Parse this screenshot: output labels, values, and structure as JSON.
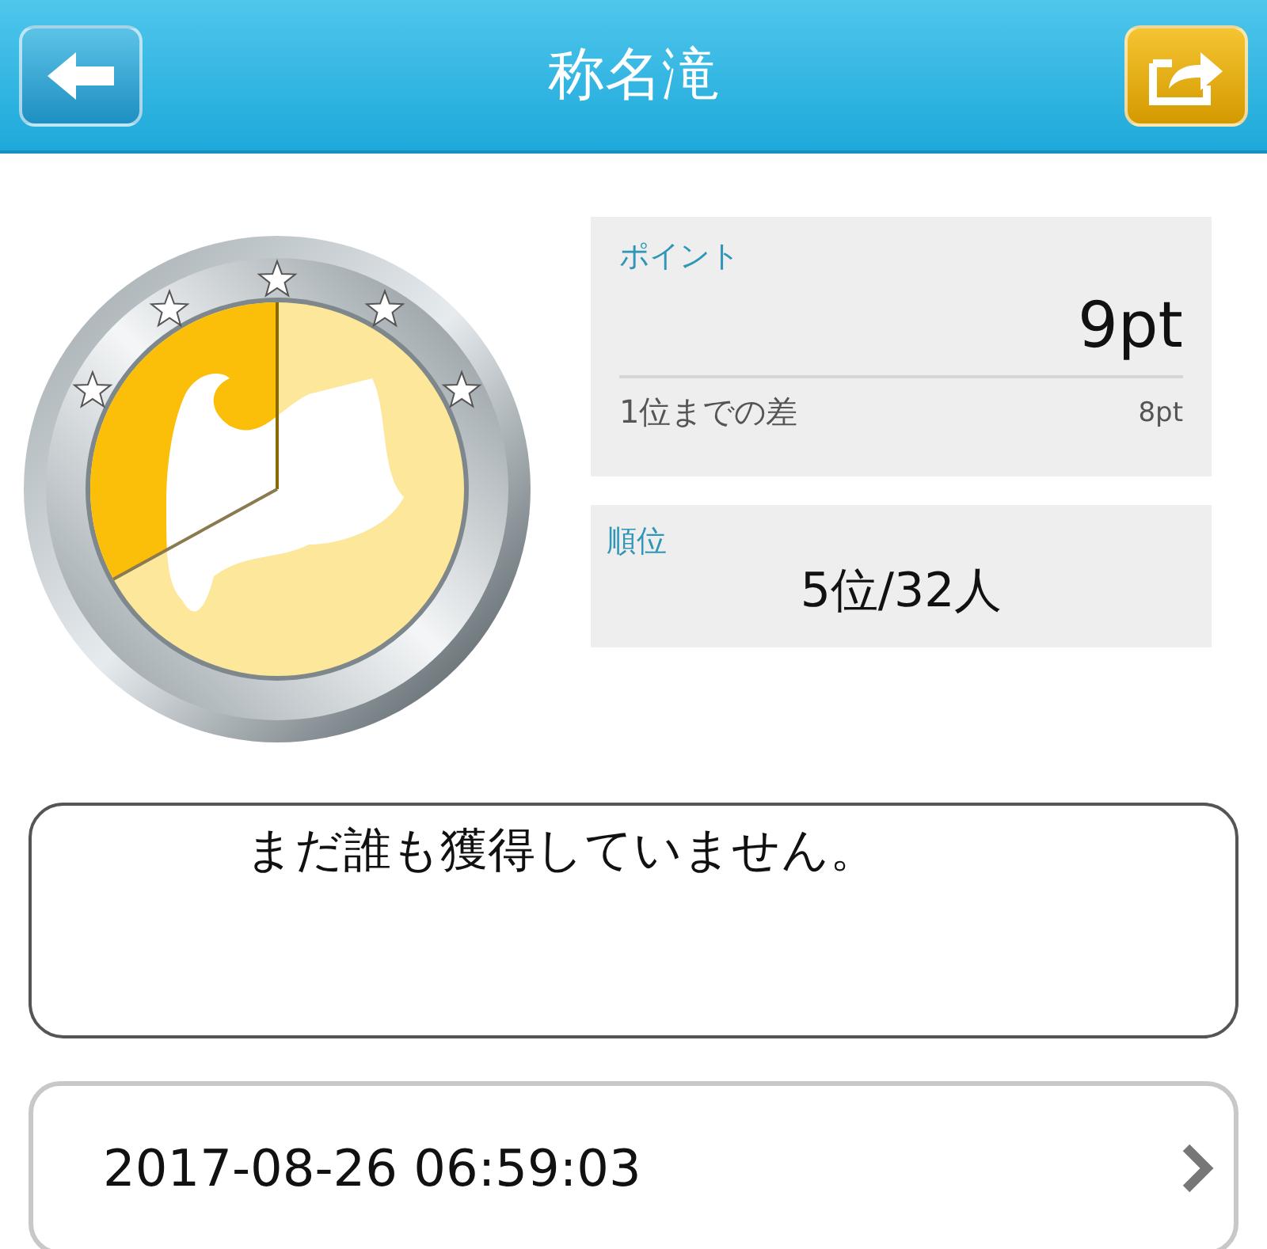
{
  "header": {
    "title": "称名滝"
  },
  "badge": {
    "level": 0.33
  },
  "points": {
    "label": "ポイント",
    "value": "9pt",
    "gap_label": "1位までの差",
    "gap_value": "8pt"
  },
  "rank": {
    "label": "順位",
    "value": "5位/32人"
  },
  "message": "まだ誰も獲得していません。",
  "date_row": {
    "text": "2017-08-26 06:59:03"
  }
}
